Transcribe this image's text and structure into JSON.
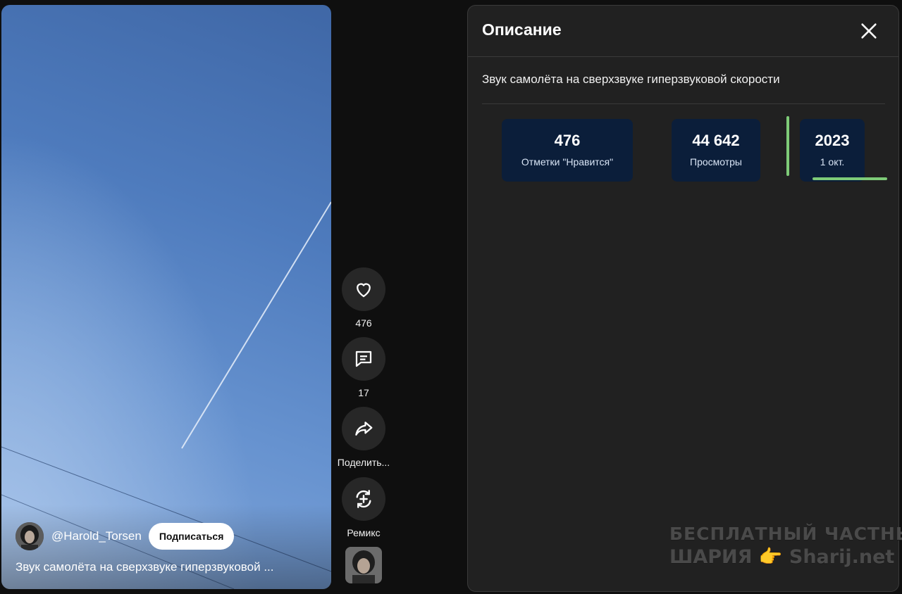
{
  "video": {
    "channel_name": "@Harold_Torsen",
    "subscribe_label": "Подписаться",
    "caption": "Звук самолёта на сверхзвуке гиперзвуковой ..."
  },
  "actions": {
    "like_count": "476",
    "comment_count": "17",
    "share_label": "Поделить...",
    "remix_label": "Ремикс"
  },
  "panel": {
    "title": "Описание",
    "description": "Звук самолёта на сверхзвуке гиперзвуковой скорости",
    "stats": [
      {
        "value": "476",
        "caption": "Отметки \"Нравится\""
      },
      {
        "value": "44 642",
        "caption": "Просмотры"
      },
      {
        "value": "2023",
        "caption": "1 окт."
      }
    ]
  },
  "watermark": {
    "line1": "БЕСПЛАТНЫЙ ЧАСТНЫЙ",
    "line2_left": "ШАРИЯ",
    "line2_right": "Sharij.net",
    "pointer_glyph": "👉"
  },
  "icons": {
    "like": "heart-icon",
    "comment": "comment-icon",
    "share": "share-arrow-icon",
    "remix": "remix-icon",
    "close": "close-icon"
  },
  "colors": {
    "background": "#0f0f0f",
    "panel": "#212121",
    "stat_card": "#0b1e3a",
    "annotation_green": "#7ecb78",
    "sky_blue": "#4e7bbd"
  }
}
